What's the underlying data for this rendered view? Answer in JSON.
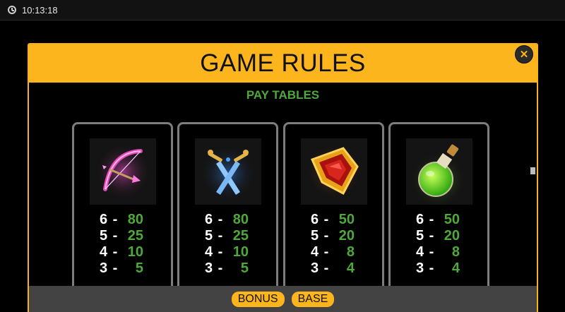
{
  "status": {
    "time": "10:13:18",
    "clock_icon": "clock-icon"
  },
  "modal": {
    "title": "GAME RULES",
    "close_icon": "close-icon",
    "header_color": "#fcb51d"
  },
  "section": {
    "title": "PAY TABLES",
    "title_color": "#4fa83a"
  },
  "cards": [
    {
      "symbol": "bow-arrow-icon",
      "pays": [
        {
          "count": "6",
          "value": "80"
        },
        {
          "count": "5",
          "value": "25"
        },
        {
          "count": "4",
          "value": "10"
        },
        {
          "count": "3",
          "value": "5"
        }
      ]
    },
    {
      "symbol": "crossed-swords-icon",
      "pays": [
        {
          "count": "6",
          "value": "80"
        },
        {
          "count": "5",
          "value": "25"
        },
        {
          "count": "4",
          "value": "10"
        },
        {
          "count": "3",
          "value": "5"
        }
      ]
    },
    {
      "symbol": "shield-icon",
      "pays": [
        {
          "count": "6",
          "value": "50"
        },
        {
          "count": "5",
          "value": "20"
        },
        {
          "count": "4",
          "value": "8"
        },
        {
          "count": "3",
          "value": "4"
        }
      ]
    },
    {
      "symbol": "potion-icon",
      "pays": [
        {
          "count": "6",
          "value": "50"
        },
        {
          "count": "5",
          "value": "20"
        },
        {
          "count": "4",
          "value": "8"
        },
        {
          "count": "3",
          "value": "4"
        }
      ]
    }
  ],
  "footer": {
    "bonus_label": "BONUS",
    "base_label": "BASE"
  }
}
